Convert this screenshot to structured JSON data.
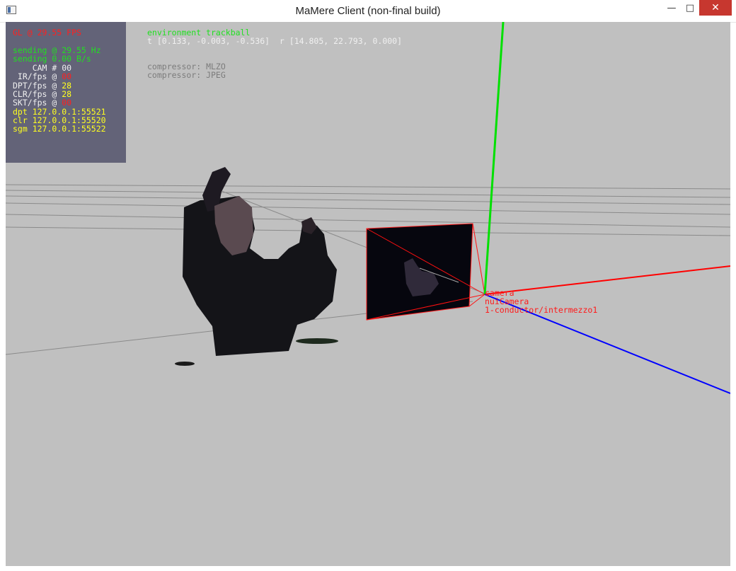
{
  "window": {
    "title": "MaMere Client (non-final build)",
    "buttons": {
      "minimize": "—",
      "maximize": "□",
      "close": "✕"
    }
  },
  "stats": {
    "gl": "GL @ 29.55 FPS",
    "sending_hz": "sending @ 29.55 Hz",
    "sending_bs": "sending 0.00 B/s",
    "rows": [
      {
        "label": "    CAM # ",
        "value": "00",
        "value_color": "#f0f0f0"
      },
      {
        "label": " IR/fps @ ",
        "value": "00",
        "value_color": "#ff2020"
      },
      {
        "label": "DPT/fps @ ",
        "value": "28",
        "value_color": "#ffff20"
      },
      {
        "label": "CLR/fps @ ",
        "value": "28",
        "value_color": "#ffff20"
      },
      {
        "label": "SKT/fps @ ",
        "value": "00",
        "value_color": "#ff2020"
      }
    ],
    "endpoints": [
      "dpt 127.0.0.1:55521",
      "clr 127.0.0.1:55520",
      "sgm 127.0.0.1:55522"
    ]
  },
  "trackball": {
    "mode": "environment trackball",
    "transform": "t [0.133, -0.003, -0.536]  r [14.805, 22.793, 0.000]"
  },
  "compressors": [
    "compressor: MLZO",
    "compressor: JPEG"
  ],
  "camera_labels": [
    "camera",
    "nuiCamera",
    "1-conductor/intermezzo1"
  ],
  "colors": {
    "viewport_bg": "#c0c0c0",
    "stats_bg": "#636378",
    "axis_x": "#ff0000",
    "axis_y": "#00e000",
    "axis_z": "#0000ff"
  }
}
